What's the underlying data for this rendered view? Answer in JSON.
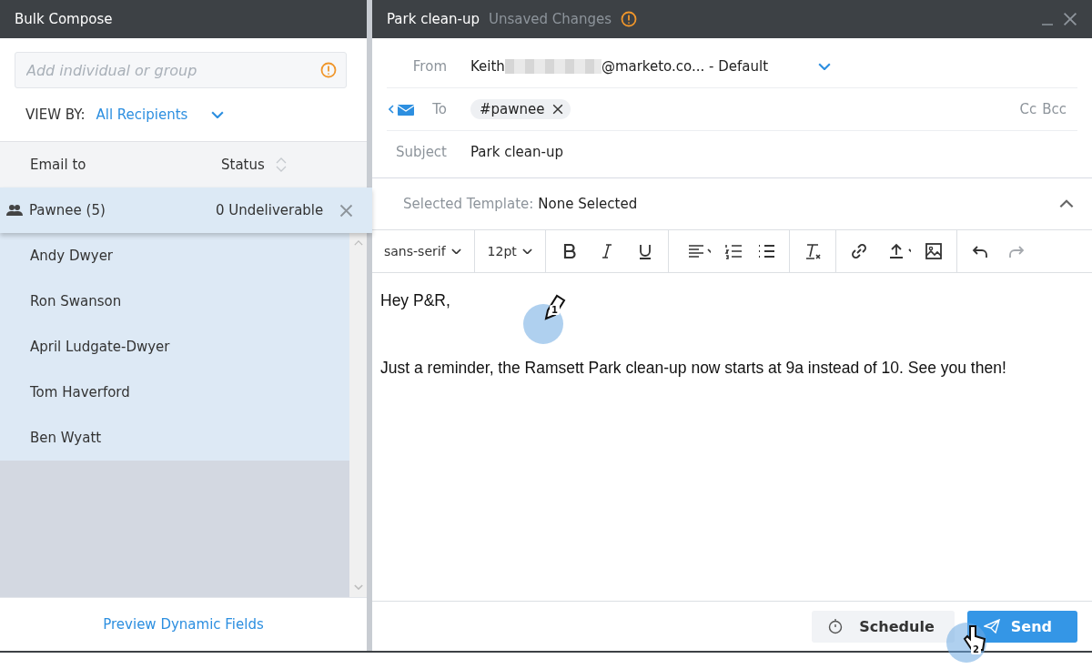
{
  "bulk_panel": {
    "title": "Bulk Compose",
    "search": {
      "placeholder": "Add individual or group"
    },
    "view_by": {
      "label": "VIEW BY:",
      "value": "All Recipients"
    },
    "columns": [
      "Email to",
      "Status"
    ],
    "group": {
      "name": "Pawnee (5)",
      "status": "Undeliverable",
      "count": "0",
      "selected": true,
      "members": [
        {
          "name": "Andy Dwyer"
        },
        {
          "name": "Ron Swanson"
        },
        {
          "name": "April Ludgate-Dwyer"
        },
        {
          "name": "Tom Haverford"
        },
        {
          "name": "Ben Wyatt"
        }
      ]
    },
    "footer_link": "Preview Dynamic Fields"
  },
  "compose": {
    "title": "Park clean-up",
    "status": "Unsaved Changes",
    "from": {
      "label": "From",
      "name": "Keith",
      "address": "@marketo.co... - Default"
    },
    "to": {
      "label": "To",
      "chips": [
        {
          "label": "#pawnee"
        }
      ],
      "cc": "Cc",
      "bcc": "Bcc"
    },
    "subject": {
      "label": "Subject",
      "value": "Park clean-up"
    },
    "template": {
      "label": "Selected Template:",
      "value": "None Selected"
    },
    "toolbar": {
      "font": "sans-serif",
      "size": "12pt"
    },
    "body": [
      {
        "text": "Hey P&R,"
      },
      {
        "text": "Just a reminder, the Ramsett Park clean-up now starts at 9a instead of 10. See you then!"
      }
    ],
    "buttons": [
      {
        "label": "Schedule",
        "kind": "secondary"
      },
      {
        "label": "Send",
        "kind": "primary"
      }
    ]
  },
  "step_markers": [
    {
      "label": "1",
      "kind": "pencil"
    },
    {
      "label": "2",
      "kind": "hand"
    }
  ]
}
